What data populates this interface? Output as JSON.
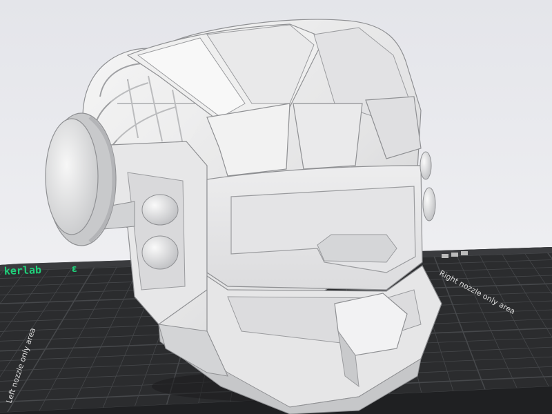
{
  "viewport": {
    "background_top": "#e4e5ea",
    "background_bottom": "#f4f4f6"
  },
  "build_plate": {
    "brand_text": "kerlab",
    "right_edge_text": "Right nozzle only area",
    "left_edge_text": "Left nozzle only area",
    "plate_color": "#2b2c2e",
    "grid_color": "#46484b",
    "brand_color": "#1fd07a",
    "edge_text_color": "#d9d9d9"
  },
  "model": {
    "name": "helmet-model",
    "base_color": "#ececec",
    "shade_color": "#cfcfd1",
    "dark_shade_color": "#a9aaad",
    "edge_color": "#8f9093"
  }
}
